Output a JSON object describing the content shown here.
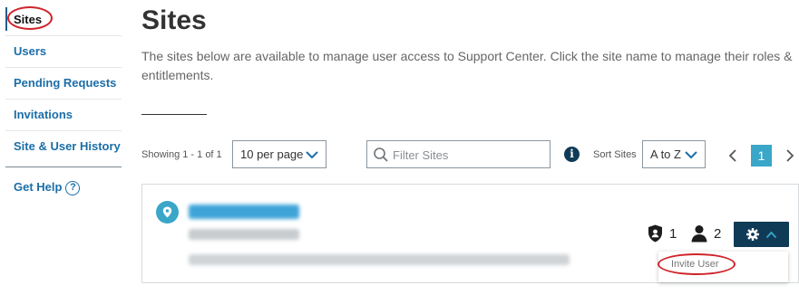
{
  "sidebar": {
    "items": [
      {
        "label": "Sites",
        "active": true
      },
      {
        "label": "Users"
      },
      {
        "label": "Pending Requests"
      },
      {
        "label": "Invitations"
      },
      {
        "label": "Site & User History"
      }
    ],
    "help": {
      "label": "Get Help",
      "icon": "question-circle-icon",
      "glyph": "?"
    }
  },
  "page": {
    "title": "Sites",
    "description": "The sites below are available to manage user access to Support Center. Click the site name to manage their roles & entitlements."
  },
  "toolbar": {
    "showing_text": "Showing 1 - 1 of 1",
    "per_page_value": "10 per page",
    "search_placeholder": "Filter Sites",
    "info_glyph": "i",
    "sort_label": "Sort Sites",
    "sort_value": "A to Z",
    "current_page": "1"
  },
  "site_card": {
    "admin_count": "1",
    "user_count": "2",
    "menu": {
      "items": [
        {
          "label": "Invite User"
        }
      ]
    }
  },
  "colors": {
    "brand_dark": "#0f3b57",
    "accent": "#3aa6c8",
    "link": "#1b6ea8",
    "highlight_annotation": "#d0242b"
  }
}
